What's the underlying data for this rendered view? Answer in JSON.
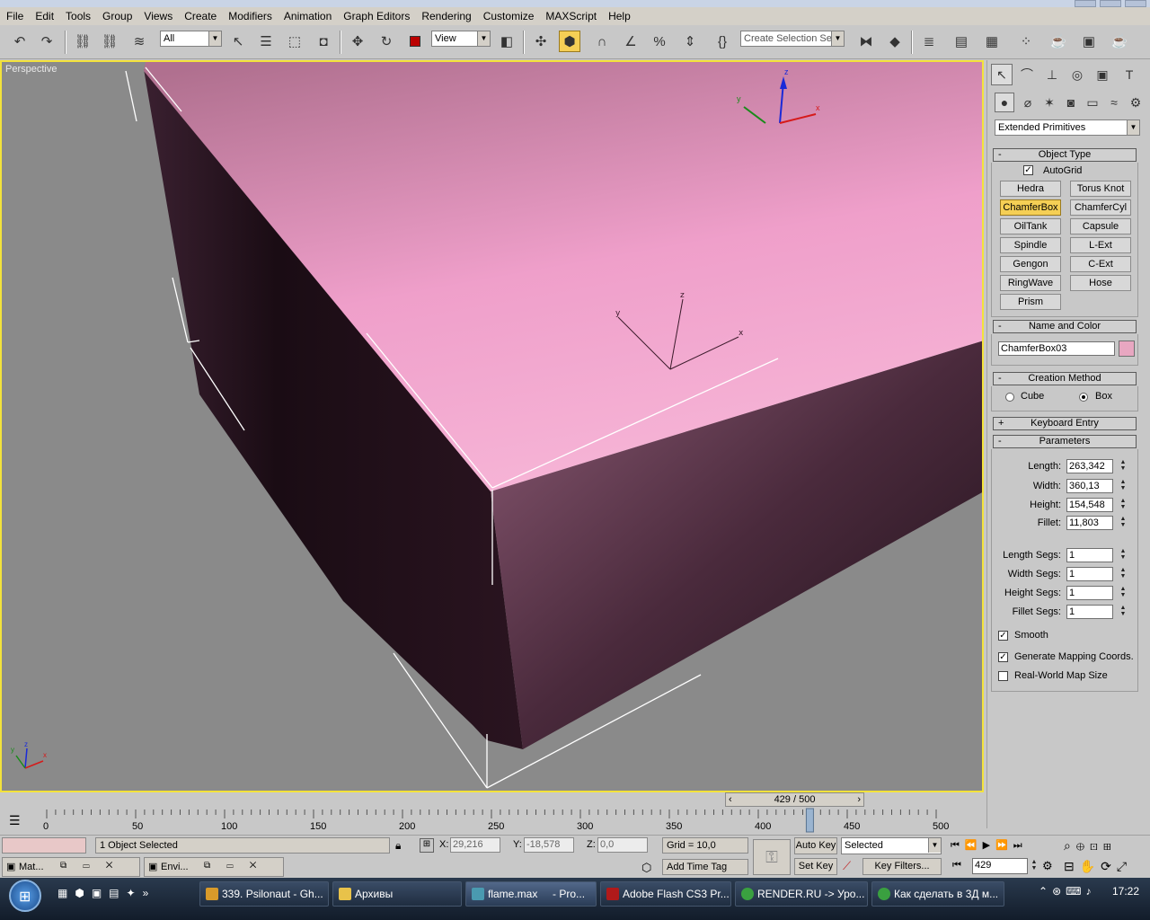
{
  "menu": [
    "File",
    "Edit",
    "Tools",
    "Group",
    "Views",
    "Create",
    "Modifiers",
    "Animation",
    "Graph Editors",
    "Rendering",
    "Customize",
    "MAXScript",
    "Help"
  ],
  "toolbar": {
    "filter_value": "All",
    "refcoord_value": "View",
    "selection_set_value": "Create Selection Set"
  },
  "viewport": {
    "label": "Perspective",
    "gizmo_axes": [
      "x",
      "y",
      "z"
    ],
    "colors": {
      "box_top": "#f1a6cd",
      "box_side": "#2a1622",
      "background": "#8a8a8a",
      "border": "#f3e23b"
    }
  },
  "panel": {
    "category_value": "Extended Primitives",
    "object_type": {
      "title": "Object Type",
      "autogrid_label": "AutoGrid",
      "autogrid_checked": true,
      "buttons": [
        "Hedra",
        "Torus Knot",
        "ChamferBox",
        "ChamferCyl",
        "OilTank",
        "Capsule",
        "Spindle",
        "L-Ext",
        "Gengon",
        "C-Ext",
        "RingWave",
        "Hose",
        "Prism"
      ],
      "active": "ChamferBox"
    },
    "name_and_color": {
      "title": "Name and Color",
      "name_value": "ChamferBox03",
      "color": "#e8a7c1"
    },
    "creation_method": {
      "title": "Creation Method",
      "cube_label": "Cube",
      "box_label": "Box",
      "selected": "Box"
    },
    "keyboard_entry": {
      "title": "Keyboard Entry"
    },
    "parameters": {
      "title": "Parameters",
      "length_label": "Length:",
      "length_value": "263,342",
      "width_label": "Width:",
      "width_value": "360,13",
      "height_label": "Height:",
      "height_value": "154,548",
      "fillet_label": "Fillet:",
      "fillet_value": "11,803",
      "length_segs_label": "Length Segs:",
      "length_segs_value": "1",
      "width_segs_label": "Width Segs:",
      "width_segs_value": "1",
      "height_segs_label": "Height Segs:",
      "height_segs_value": "1",
      "fillet_segs_label": "Fillet Segs:",
      "fillet_segs_value": "1",
      "smooth_label": "Smooth",
      "smooth_checked": true,
      "mapping_label": "Generate Mapping Coords.",
      "mapping_checked": true,
      "realworld_label": "Real-World Map Size",
      "realworld_checked": false
    }
  },
  "timeline": {
    "slider_text": "429 / 500",
    "current_frame": 429,
    "total_frames": 500,
    "ticks": [
      "0",
      "50",
      "100",
      "150",
      "200",
      "250",
      "300",
      "350",
      "400",
      "450",
      "500"
    ]
  },
  "status": {
    "selection_text": "1 Object Selected",
    "x_label": "X:",
    "x_value": "29,216",
    "y_label": "Y:",
    "y_value": "-18,578",
    "z_label": "Z:",
    "z_value": "0,0",
    "grid_text": "Grid = 10,0",
    "add_time_tag": "Add Time Tag",
    "auto_key": "Auto Key",
    "key_mode_value": "Selected",
    "set_key": "Set Key",
    "key_filters": "Key Filters...",
    "frame_value": "429",
    "mini_windows": [
      "Mat...",
      "Envi..."
    ]
  },
  "taskbar": {
    "tasks": [
      "339. Psilonaut - Gh...",
      "Архивы",
      "flame.max     - Pro...",
      "Adobe Flash CS3 Pr...",
      "RENDER.RU -> Уро...",
      "Как сделать в 3Д м..."
    ],
    "clock": "17:22"
  }
}
